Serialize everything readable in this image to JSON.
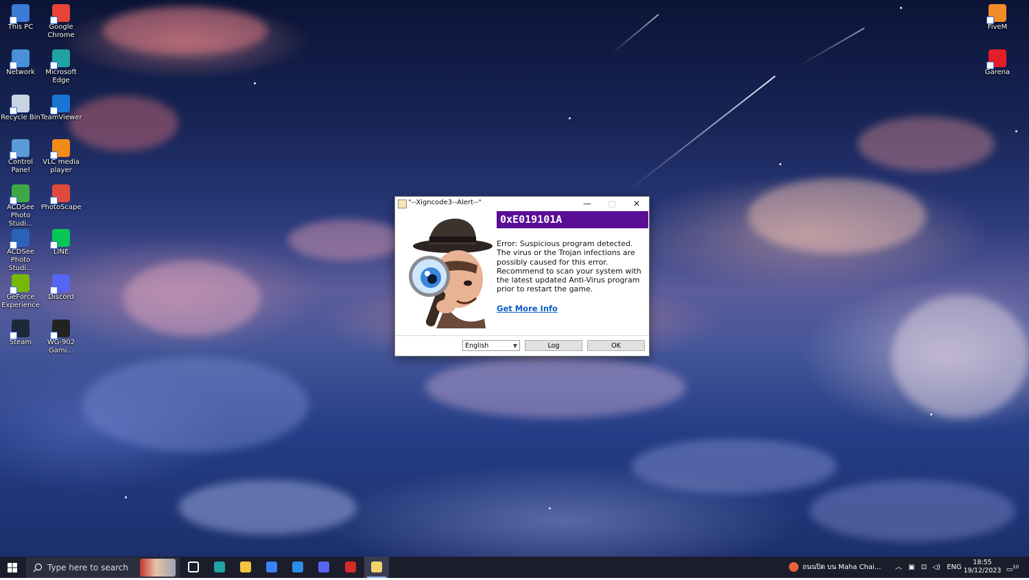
{
  "desktop": {
    "icons_left": [
      {
        "label": "This PC",
        "icon": "this-pc-icon",
        "color": "#3a7bd5"
      },
      {
        "label": "Google Chrome",
        "icon": "chrome-icon",
        "color": "#e94335"
      },
      {
        "label": "Network",
        "icon": "network-icon",
        "color": "#4a90d9"
      },
      {
        "label": "Microsoft Edge",
        "icon": "edge-icon",
        "color": "#1fa4a3"
      },
      {
        "label": "Recycle Bin",
        "icon": "recycle-bin-icon",
        "color": "#c9d4e0"
      },
      {
        "label": "TeamViewer",
        "icon": "teamviewer-icon",
        "color": "#1a74d2"
      },
      {
        "label": "Control Panel",
        "icon": "control-panel-icon",
        "color": "#5b9bd5"
      },
      {
        "label": "VLC media player",
        "icon": "vlc-icon",
        "color": "#f28a18"
      },
      {
        "label": "ACDSee Photo Studi...",
        "icon": "acdsee-whats-new-icon",
        "color": "#3fa845"
      },
      {
        "label": "PhotoScape",
        "icon": "photoscape-icon",
        "color": "#e04a3a"
      },
      {
        "label": "ACDSee Photo Studi...",
        "icon": "acdsee-icon",
        "color": "#2a63b8"
      },
      {
        "label": "LINE",
        "icon": "line-icon",
        "color": "#06c755"
      },
      {
        "label": "GeForce Experience",
        "icon": "geforce-icon",
        "color": "#76b900"
      },
      {
        "label": "Discord",
        "icon": "discord-icon",
        "color": "#5865f2"
      },
      {
        "label": "Steam",
        "icon": "steam-icon",
        "color": "#1b2838"
      },
      {
        "label": "WG-902 Gami...",
        "icon": "wg902-icon",
        "color": "#222222"
      }
    ],
    "icons_right": [
      {
        "label": "FiveM",
        "icon": "fivem-icon",
        "color": "#f28c28"
      },
      {
        "label": "Garena",
        "icon": "garena-icon",
        "color": "#e41e26"
      }
    ]
  },
  "dialog": {
    "title": "\"--Xigncode3--Alert--\"",
    "minimize": "—",
    "maximize": "□",
    "close": "✕",
    "error_code": "0xE019101A",
    "message": "Error: Suspicious program detected. The virus or the Trojan infections are possibly caused for this error. Recommend to scan your system with the latest updated Anti-Virus program prior to restart the game.",
    "link": "Get More Info",
    "language": "English",
    "log_button": "Log",
    "ok_button": "OK",
    "accent_color": "#5a0e96"
  },
  "taskbar": {
    "search_placeholder": "Type here to search",
    "apps": [
      {
        "name": "task-view",
        "icon": "task-view-icon"
      },
      {
        "name": "edge",
        "icon": "edge-icon"
      },
      {
        "name": "file-explorer",
        "icon": "folder-icon"
      },
      {
        "name": "microsoft-store",
        "icon": "store-icon"
      },
      {
        "name": "mail",
        "icon": "mail-icon"
      },
      {
        "name": "discord",
        "icon": "discord-icon"
      },
      {
        "name": "garena",
        "icon": "garena-icon"
      },
      {
        "name": "xigncode-alert",
        "icon": "notepad-icon"
      }
    ],
    "weather_text": "ถนนปิด บน Maha Chai...",
    "language": "ENG",
    "time": "18:55",
    "date": "19/12/2023",
    "notification_count": "10"
  }
}
